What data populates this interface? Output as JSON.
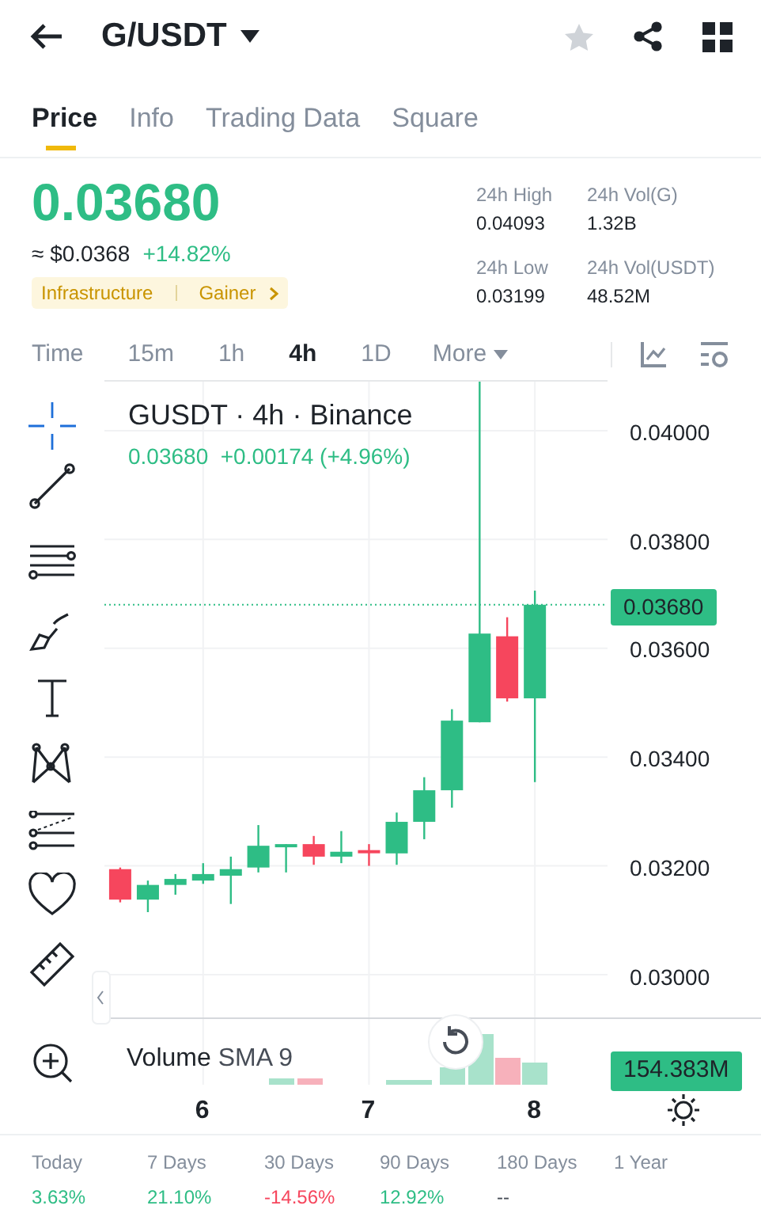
{
  "header": {
    "title": "G/USDT",
    "favorite": false
  },
  "tabs": [
    {
      "label": "Price",
      "selected": true
    },
    {
      "label": "Info",
      "selected": false
    },
    {
      "label": "Trading Data",
      "selected": false
    },
    {
      "label": "Square",
      "selected": false
    }
  ],
  "price": {
    "last": "0.03680",
    "fiat": "≈ $0.0368",
    "change": "+14.82%",
    "tags": [
      "Infrastructure",
      "Gainer"
    ]
  },
  "stats": [
    {
      "label": "24h High",
      "value": "0.04093"
    },
    {
      "label": "24h Vol(G)",
      "value": "1.32B"
    },
    {
      "label": "24h Low",
      "value": "0.03199"
    },
    {
      "label": "24h Vol(USDT)",
      "value": "48.52M"
    }
  ],
  "intervals": [
    {
      "label": "Time",
      "selected": false
    },
    {
      "label": "15m",
      "selected": false
    },
    {
      "label": "1h",
      "selected": false
    },
    {
      "label": "4h",
      "selected": true
    },
    {
      "label": "1D",
      "selected": false
    }
  ],
  "more": "More",
  "chart": {
    "title": "GUSDT · 4h · Binance",
    "last": "0.03680",
    "change": "+0.00174 (+4.96%)",
    "volume_title": "Volume",
    "volume_sma": "SMA 9",
    "volume_label": "154.383M",
    "chart_data": {
      "type": "candlestick",
      "x": [
        5.5,
        5.667,
        5.833,
        6,
        6.167,
        6.333,
        6.5,
        6.667,
        6.833,
        7,
        7.167,
        7.333,
        7.5,
        7.667,
        7.833,
        8
      ],
      "ohlc": [
        [
          0.03194,
          0.03197,
          0.03133,
          0.03138
        ],
        [
          0.03138,
          0.03173,
          0.03115,
          0.03165
        ],
        [
          0.03165,
          0.03185,
          0.03147,
          0.03176
        ],
        [
          0.03173,
          0.03205,
          0.03167,
          0.03185
        ],
        [
          0.03182,
          0.03217,
          0.0313,
          0.03194
        ],
        [
          0.03197,
          0.03275,
          0.03188,
          0.03237
        ],
        [
          0.03237,
          0.0324,
          0.03188,
          0.0324
        ],
        [
          0.0324,
          0.03255,
          0.03202,
          0.03217
        ],
        [
          0.03217,
          0.03264,
          0.03205,
          0.03226
        ],
        [
          0.03229,
          0.0324,
          0.032,
          0.03226
        ],
        [
          0.03223,
          0.03298,
          0.03202,
          0.03281
        ],
        [
          0.03281,
          0.03363,
          0.03249,
          0.03339
        ],
        [
          0.03339,
          0.03488,
          0.03307,
          0.03467
        ],
        [
          0.03464,
          0.04093,
          0.03464,
          0.03627
        ],
        [
          0.03622,
          0.03657,
          0.03502,
          0.03508
        ],
        [
          0.03508,
          0.03706,
          0.03354,
          0.0368
        ]
      ],
      "ylim": [
        0.0292,
        0.04093
      ],
      "xlim": [
        5.405,
        8.438
      ],
      "grid": true,
      "ref_lines": [
        {
          "axis": "y",
          "value": 0.0368,
          "label": "0.03680"
        }
      ],
      "yticks": [
        {
          "value": 0.04,
          "label": "0.04000"
        },
        {
          "value": 0.038,
          "label": "0.03800"
        },
        {
          "value": 0.036,
          "label": "0.03600"
        },
        {
          "value": 0.034,
          "label": "0.03400"
        },
        {
          "value": 0.032,
          "label": "0.03200"
        },
        {
          "value": 0.03,
          "label": "0.03000"
        }
      ],
      "xticks": [
        6,
        7,
        8
      ]
    }
  },
  "performance": [
    {
      "period": "Today",
      "value": "3.63%",
      "color": "#2ebd85"
    },
    {
      "period": "7 Days",
      "value": "21.10%",
      "color": "#2ebd85"
    },
    {
      "period": "30 Days",
      "value": "-14.56%",
      "color": "#f6465d"
    },
    {
      "period": "90 Days",
      "value": "12.92%",
      "color": "#2ebd85"
    },
    {
      "period": "180 Days",
      "value": "--",
      "color": "#474d57"
    },
    {
      "period": "1 Year"
    }
  ]
}
